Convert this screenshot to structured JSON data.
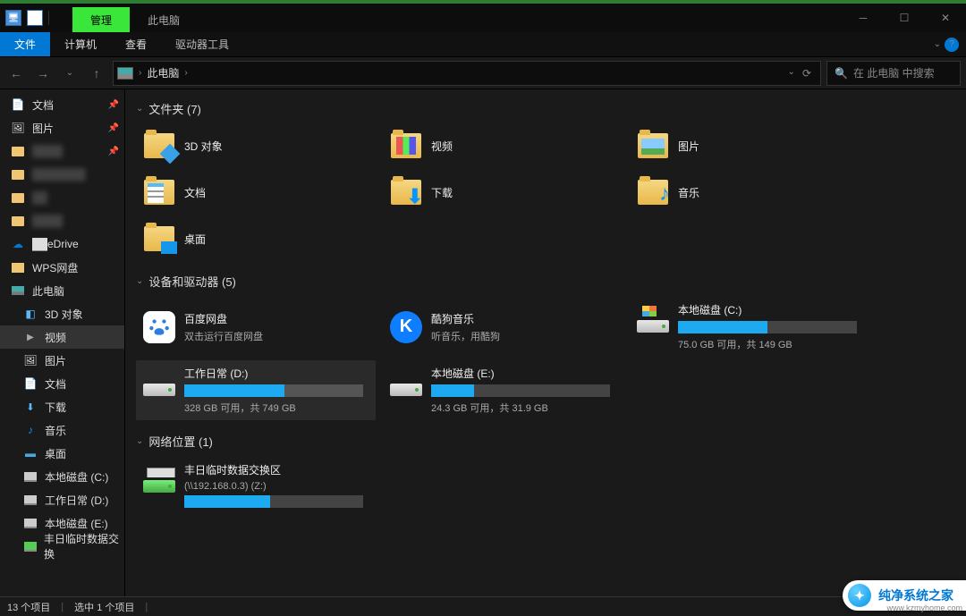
{
  "titlebar": {
    "tab_manage": "管理",
    "tab_context": "此电脑"
  },
  "ribbon": {
    "file": "文件",
    "computer": "计算机",
    "view": "查看",
    "drive_tools": "驱动器工具"
  },
  "nav": {
    "location": "此电脑",
    "search_placeholder": "在 此电脑 中搜索"
  },
  "sidebar": [
    {
      "icon": "doc",
      "label": "文档",
      "pin": true
    },
    {
      "icon": "pic",
      "label": "图片",
      "pin": true
    },
    {
      "icon": "folder",
      "label": "████",
      "pin": true,
      "hidden": true
    },
    {
      "icon": "folder",
      "label": "███████",
      "hidden": true
    },
    {
      "icon": "folder",
      "label": "██",
      "hidden": true
    },
    {
      "icon": "folder",
      "label": "████",
      "hidden": true
    },
    {
      "icon": "cloud",
      "label": "██eDrive",
      "partial": true
    },
    {
      "icon": "wps",
      "label": "WPS网盘"
    },
    {
      "icon": "pc",
      "label": "此电脑",
      "sel": false
    },
    {
      "icon": "3d",
      "label": "3D 对象",
      "lv2": true
    },
    {
      "icon": "video",
      "label": "视频",
      "lv2": true,
      "sel": true
    },
    {
      "icon": "pic",
      "label": "图片",
      "lv2": true
    },
    {
      "icon": "doc",
      "label": "文档",
      "lv2": true
    },
    {
      "icon": "download",
      "label": "下载",
      "lv2": true
    },
    {
      "icon": "music",
      "label": "音乐",
      "lv2": true
    },
    {
      "icon": "desktop",
      "label": "桌面",
      "lv2": true
    },
    {
      "icon": "drive",
      "label": "本地磁盘 (C:)",
      "lv2": true
    },
    {
      "icon": "drive",
      "label": "工作日常 (D:)",
      "lv2": true
    },
    {
      "icon": "drive",
      "label": "本地磁盘 (E:)",
      "lv2": true
    },
    {
      "icon": "net",
      "label": "丰日临时数据交换",
      "lv2": true
    }
  ],
  "groups": {
    "folders": {
      "title": "文件夹 (7)",
      "items": [
        {
          "name": "3D 对象",
          "cls": "f-3d"
        },
        {
          "name": "视频",
          "cls": "f-video"
        },
        {
          "name": "图片",
          "cls": "f-pic"
        },
        {
          "name": "文档",
          "cls": "f-doc"
        },
        {
          "name": "下载",
          "cls": "f-download"
        },
        {
          "name": "音乐",
          "cls": "f-music"
        },
        {
          "name": "桌面",
          "cls": "f-desktop"
        }
      ]
    },
    "devices": {
      "title": "设备和驱动器 (5)",
      "items": [
        {
          "type": "app",
          "name": "百度网盘",
          "sub": "双击运行百度网盘",
          "cls": "baidu"
        },
        {
          "type": "app",
          "name": "酷狗音乐",
          "sub": "听音乐，用酷狗",
          "cls": "kugou",
          "char": "K"
        },
        {
          "type": "drive",
          "name": "本地磁盘 (C:)",
          "sub": "75.0 GB 可用，共 149 GB",
          "fill": 50,
          "cls": "cdrive"
        },
        {
          "type": "drive",
          "name": "工作日常 (D:)",
          "sub": "328 GB 可用，共 749 GB",
          "fill": 56,
          "sel": true
        },
        {
          "type": "drive",
          "name": "本地磁盘 (E:)",
          "sub": "24.3 GB 可用，共 31.9 GB",
          "fill": 24
        }
      ]
    },
    "network": {
      "title": "网络位置 (1)",
      "items": [
        {
          "type": "net",
          "name": "丰日临时数据交换区",
          "sub": "(\\\\192.168.0.3) (Z:)",
          "fill": 48
        }
      ]
    }
  },
  "status": {
    "count": "13 个项目",
    "selected": "选中 1 个项目"
  },
  "watermark": {
    "text": "纯净系统之家",
    "url": "www.kzmyhome.com"
  }
}
